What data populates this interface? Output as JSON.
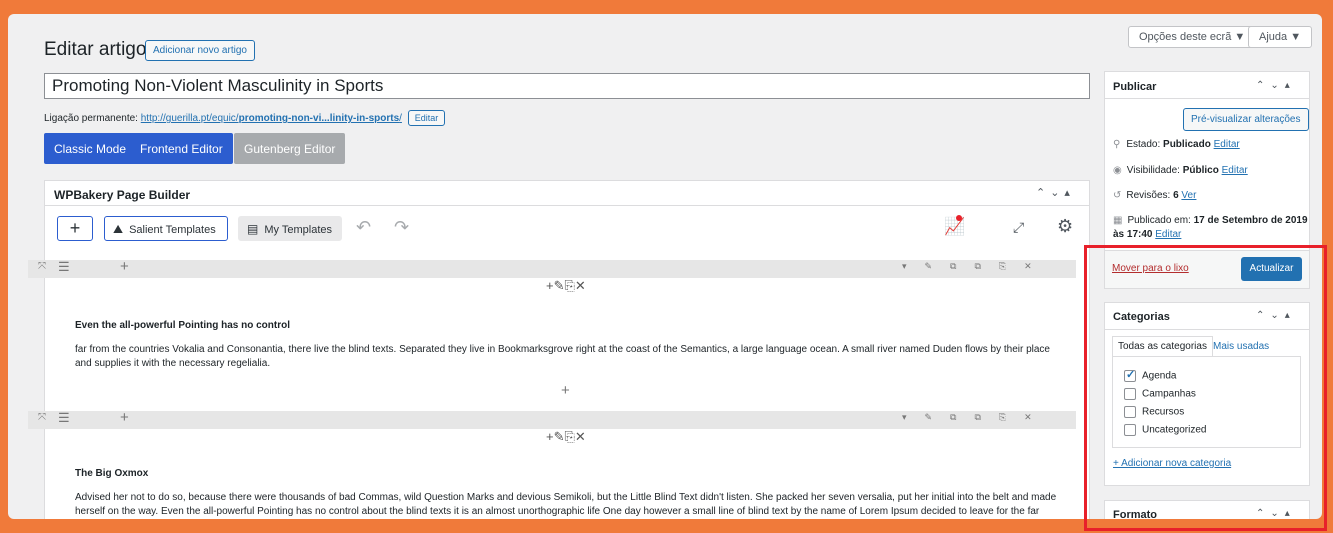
{
  "header": {
    "title": "Editar artigo",
    "add_new": "Adicionar novo artigo",
    "screen_options": "Opções deste ecrã ▼",
    "help": "Ajuda ▼"
  },
  "post": {
    "title": "Promoting Non-Violent Masculinity in Sports",
    "permalink_label": "Ligação permanente:",
    "permalink_base": "http://guerilla.pt/equic/",
    "permalink_slug": "promoting-non-vi...linity-in-sports",
    "permalink_trail": "/",
    "permalink_edit": "Editar"
  },
  "editor_modes": {
    "classic": "Classic Mode",
    "frontend": "Frontend Editor",
    "gutenberg": "Gutenberg Editor"
  },
  "wpbakery": {
    "title": "WPBakery Page Builder",
    "salient_templates": "Salient Templates",
    "my_templates": "My Templates",
    "rows": [
      {
        "heading": "Even the all-powerful Pointing has no control",
        "text": "far from the countries Vokalia and Consonantia, there live the blind texts. Separated they live in Bookmarksgrove right at the coast of the Semantics, a large language ocean. A small river named Duden flows by their place and supplies it with the necessary regelialia."
      },
      {
        "heading": "The Big Oxmox",
        "text": "Advised her not to do so, because there were thousands of bad Commas, wild Question Marks and devious Semikoli, but the Little Blind Text didn't listen. She packed her seven versalia, put her initial into the belt and made herself on the way.  Even the all-powerful Pointing has no control about the blind texts it is an almost unorthographic life One day however a small line of blind text by the name of Lorem Ipsum decided to leave for the far World of"
      }
    ]
  },
  "publish": {
    "title": "Publicar",
    "preview": "Pré-visualizar alterações",
    "status_label": "Estado:",
    "status_value": "Publicado",
    "visibility_label": "Visibilidade:",
    "visibility_value": "Público",
    "revisions_label": "Revisões:",
    "revisions_value": "6",
    "revisions_link": "Ver",
    "published_label": "Publicado em:",
    "published_value": "17 de Setembro de 2019",
    "published_time": "às 17:40",
    "edit": "Editar",
    "trash": "Mover para o lixo",
    "update": "Actualizar"
  },
  "categories": {
    "title": "Categorias",
    "tab_all": "Todas as categorias",
    "tab_used": "Mais usadas",
    "items": [
      {
        "label": "Agenda",
        "checked": true
      },
      {
        "label": "Campanhas",
        "checked": false
      },
      {
        "label": "Recursos",
        "checked": false
      },
      {
        "label": "Uncategorized",
        "checked": false
      }
    ],
    "add_new": "+ Adicionar nova categoria"
  },
  "format": {
    "title": "Formato"
  },
  "colors": {
    "primary_blue": "#2c5dcf",
    "wp_blue": "#2271b1",
    "highlight_red": "#e8202a",
    "background_orange": "#f07a3a"
  }
}
